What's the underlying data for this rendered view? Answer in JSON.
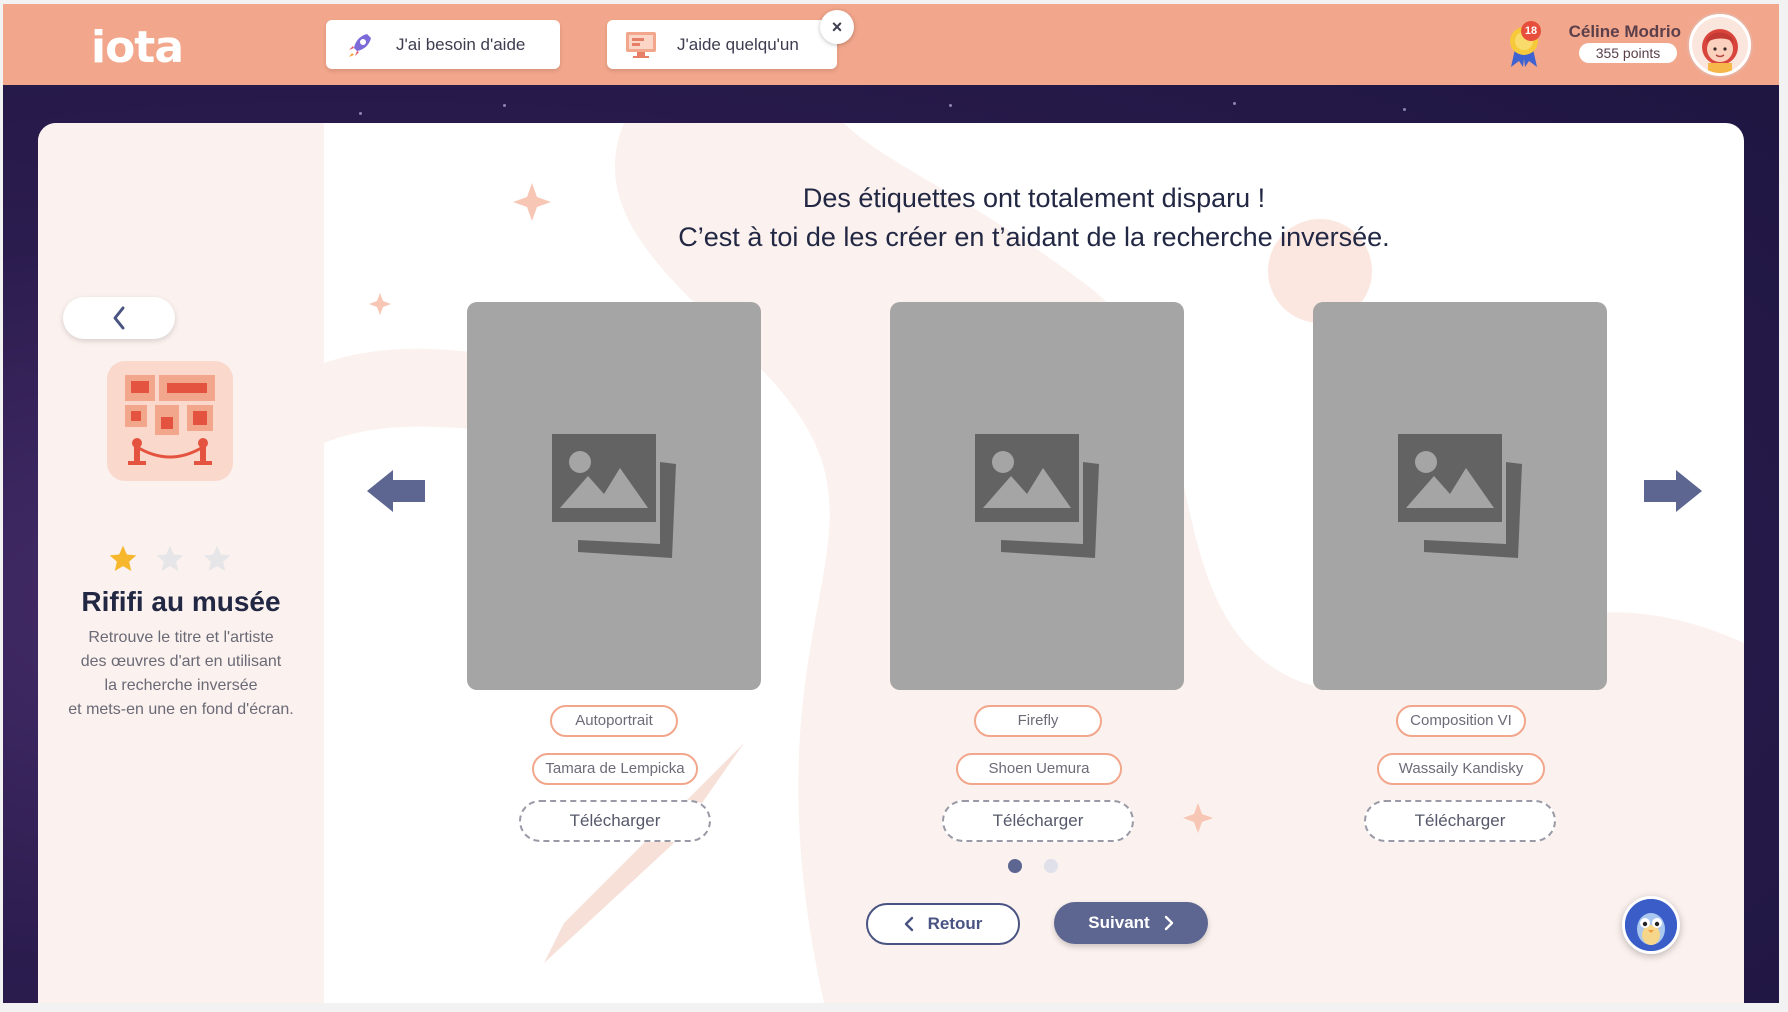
{
  "app": {
    "logo": "iota"
  },
  "topbar": {
    "help_buttons": [
      {
        "label": "J'ai besoin d'aide",
        "icon": "rocket-icon"
      },
      {
        "label": "J'aide quelqu'un",
        "icon": "monitor-icon"
      }
    ],
    "close_label": "×",
    "medal_count": "18",
    "user": {
      "name": "Céline Modrio",
      "points": "355 points"
    }
  },
  "sidebar": {
    "activity_title": "Rififi au musée",
    "description_lines": [
      "Retrouve le titre et l'artiste",
      "des œuvres d'art en utilisant",
      "la recherche inversée",
      "et mets-en une en fond d'écran."
    ],
    "rating": {
      "filled": 1,
      "total": 3
    }
  },
  "main": {
    "heading_line1": "Des étiquettes ont totalement disparu !",
    "heading_line2": "C’est à toi de les créer en t’aidant de la recherche inversée.",
    "items": [
      {
        "title": "Autoportrait",
        "artist": "Tamara de Lempicka",
        "download": "Télécharger"
      },
      {
        "title": "Firefly",
        "artist": "Shoen Uemura",
        "download": "Télécharger"
      },
      {
        "title": "Composition VI",
        "artist": "Wassaily Kandisky",
        "download": "Télécharger"
      }
    ],
    "pagination": {
      "current": 1,
      "total": 2
    },
    "back_button": "Retour",
    "next_button": "Suivant"
  },
  "colors": {
    "topbar": "#f2a68b",
    "primary": "#5c6690",
    "tag_border": "#f2a68b",
    "heading": "#222844"
  }
}
